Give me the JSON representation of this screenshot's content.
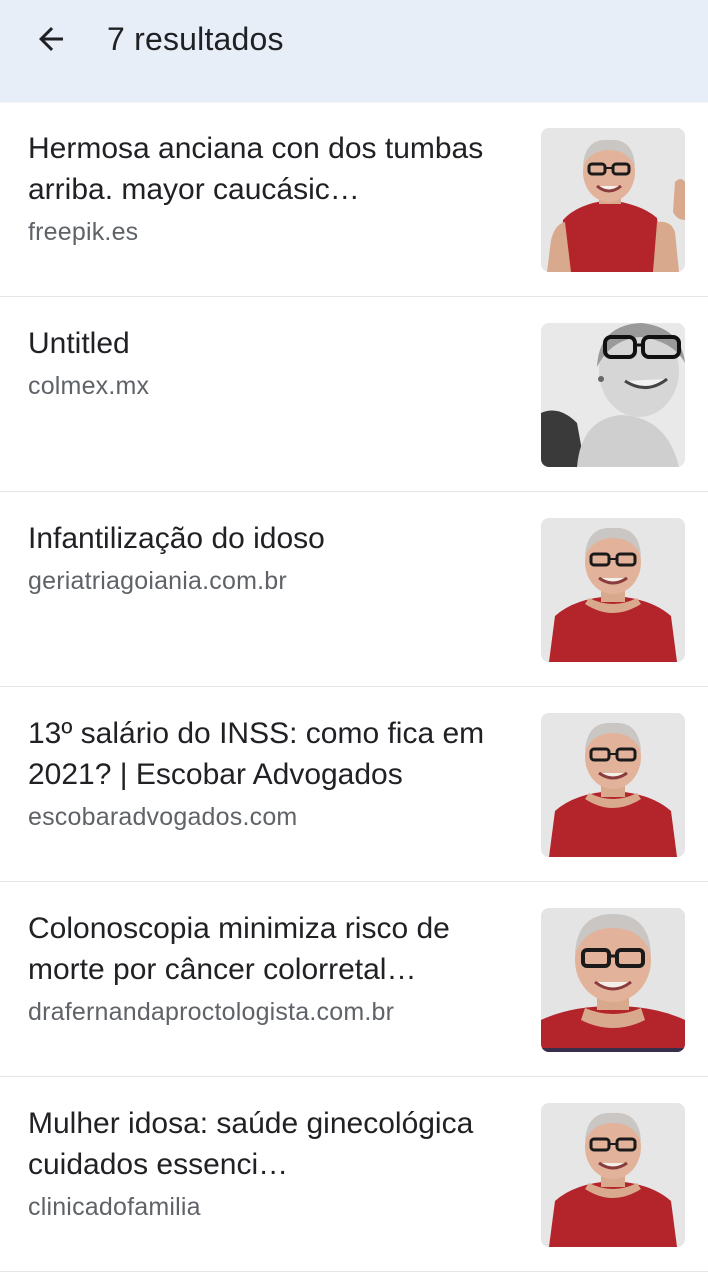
{
  "header": {
    "back_icon": "arrow-left-icon",
    "title": "7 resultados",
    "background": "#e8eef8"
  },
  "results": [
    {
      "title": "Hermosa anciana con dos tumbas arriba. mayor caucásic…",
      "source": "freepik.es",
      "thumbnail": "smiling-elderly-woman-red-top-thumbs-up"
    },
    {
      "title": "Untitled",
      "source": "colmex.mx",
      "thumbnail": "smiling-elderly-woman-black-and-white"
    },
    {
      "title": "Infantilização do idoso",
      "source": "geriatriagoiania.com.br",
      "thumbnail": "smiling-elderly-woman-red-top"
    },
    {
      "title": "13º salário do INSS: como fica em 2021? | Escobar Advogados",
      "source": "escobaradvogados.com",
      "thumbnail": "smiling-elderly-woman-red-top"
    },
    {
      "title": "Colonoscopia minimiza risco de morte por câncer colorretal…",
      "source": "drafernandaproctologista.com.br",
      "thumbnail": "smiling-elderly-woman-red-top-closeup"
    },
    {
      "title": "Mulher idosa: saúde ginecológica cuidados essenci…",
      "source": "clinicadofamilia",
      "thumbnail": "smiling-elderly-woman-red-top"
    }
  ],
  "colors": {
    "title_text": "#202124",
    "source_text": "#5f6368",
    "shirt_red": "#b3242b"
  }
}
